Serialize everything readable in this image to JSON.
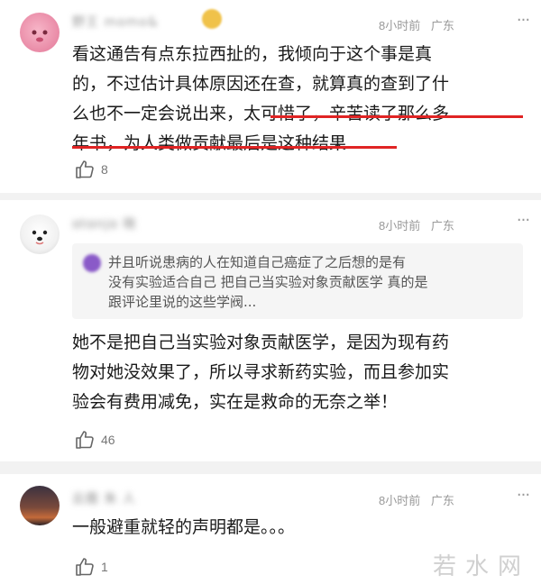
{
  "comments": [
    {
      "username": "野王 momo&",
      "time": "8小时前",
      "location": "广东",
      "more": "···",
      "lines": [
        "看这通告有点东拉西扯的，我倾向于这个事是真",
        "的，不过估计具体原因还在查，就算真的查到了什",
        "么也不一定会说出来，太可惜了，辛苦读了那么多",
        "年书，为人类做贡献最后是这种结果"
      ],
      "likes": "8"
    },
    {
      "username": "ɑtɑnjɑ 晓",
      "time": "8小时前",
      "location": "广东",
      "more": "···",
      "quote_lines": [
        "并且听说患病的人在知道自己癌症了之后想的是有",
        "没有实验适合自己 把自己当实验对象贡献医学 真的是",
        "跟评论里说的这些学阀..."
      ],
      "lines": [
        "她不是把自己当实验对象贡献医学，是因为现有药",
        "物对她没效果了，所以寻求新药实验，而且参加实",
        "验会有费用减免，实在是救命的无奈之举！"
      ],
      "likes": "46"
    },
    {
      "username": "云霞 朱 人",
      "time": "8小时前",
      "location": "广东",
      "more": "···",
      "lines": [
        "一般避重就轻的声明都是。。。"
      ],
      "likes": "1"
    }
  ],
  "watermark": "若水网",
  "colors": {
    "highlight_underline": "#e02424",
    "meta_text": "#999999",
    "divider": "#f2f2f2"
  }
}
